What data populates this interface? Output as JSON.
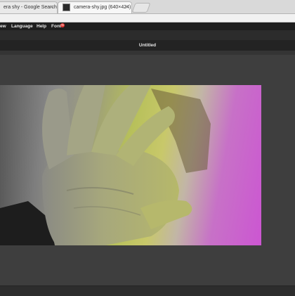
{
  "browser": {
    "tabs": [
      {
        "label": "era shy - Google Search"
      },
      {
        "label": "camera-shy.jpg (640×424)"
      }
    ]
  },
  "menu": {
    "items": [
      "ew",
      "Language",
      "Help",
      "Font"
    ],
    "font_badge": "N"
  },
  "document": {
    "title": "Untitled"
  },
  "colors": {
    "menubar": "#1e1e1e",
    "workspace": "#3e3e3e",
    "badge": "#e53935",
    "magenta": "#cc56d2",
    "yellow_green": "#b7c05a"
  }
}
